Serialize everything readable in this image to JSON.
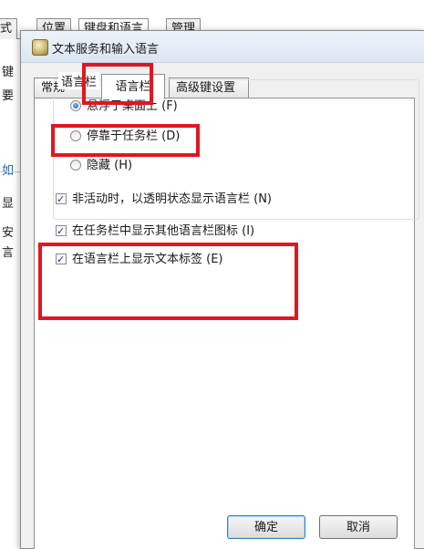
{
  "back_window": {
    "tabs": [
      "式",
      "位置",
      "键盘和语言",
      "管理"
    ],
    "side_texts": [
      "键",
      "要",
      "如",
      "显",
      "安",
      "言"
    ]
  },
  "dialog": {
    "title": "文本服务和输入语言",
    "tabs": [
      {
        "label": "常规"
      },
      {
        "label": "语言栏"
      },
      {
        "label": "高级键设置"
      }
    ],
    "group_label": "语言栏",
    "radios": [
      {
        "label": "悬浮于桌面上 (F)",
        "checked": true
      },
      {
        "label": "停靠于任务栏 (D)",
        "checked": false
      },
      {
        "label": "隐藏 (H)",
        "checked": false
      }
    ],
    "checkboxes": [
      {
        "label": "非活动时，以透明状态显示语言栏 (N)",
        "checked": true
      },
      {
        "label": "在任务栏中显示其他语言栏图标 (I)",
        "checked": true
      },
      {
        "label": "在语言栏上显示文本标签 (E)",
        "checked": true
      }
    ],
    "buttons": {
      "ok": "确定",
      "cancel": "取消"
    }
  },
  "colors": {
    "highlight": "#e01620",
    "accent": "#1f57b8"
  }
}
